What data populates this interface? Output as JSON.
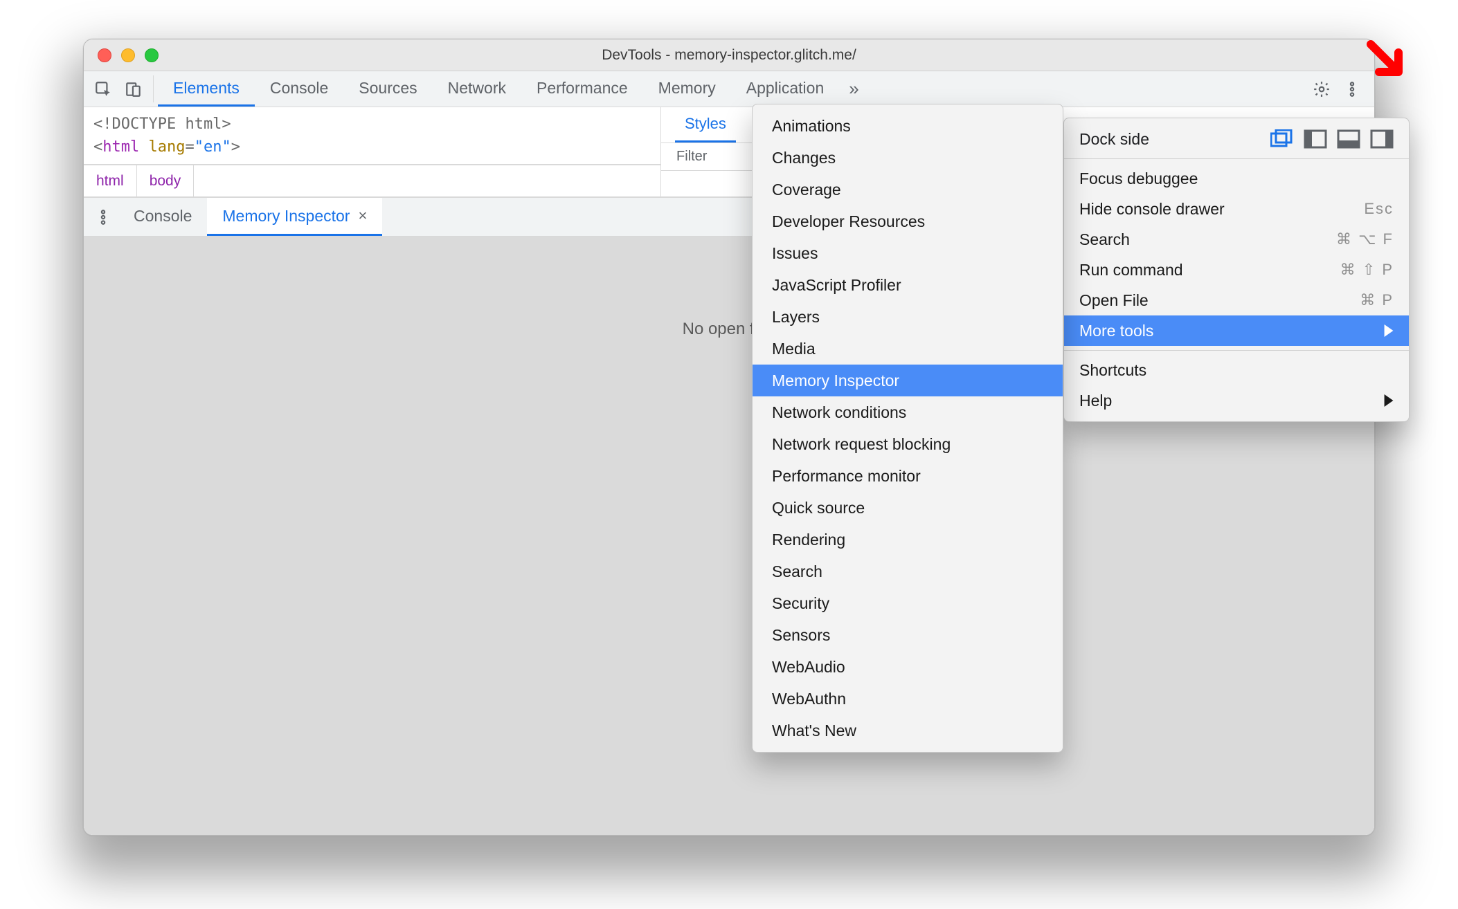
{
  "window": {
    "title": "DevTools - memory-inspector.glitch.me/"
  },
  "tabs": [
    "Elements",
    "Console",
    "Sources",
    "Network",
    "Performance",
    "Memory",
    "Application"
  ],
  "active_tab_index": 0,
  "overflow_glyph": "»",
  "code_line1": "<!DOCTYPE html>",
  "code_line2_pre": "<",
  "code_line2_tag": "html",
  "code_line2_sp": " ",
  "code_line2_attr": "lang",
  "code_line2_eq": "=",
  "code_line2_val": "\"en\"",
  "code_line2_post": ">",
  "breadcrumbs": [
    "html",
    "body"
  ],
  "styles_tabs": [
    "Styles"
  ],
  "filter_label": "Filter",
  "drawer": {
    "tabs": [
      "Console",
      "Memory Inspector"
    ],
    "active_index": 1,
    "body_notice": "No open file."
  },
  "settings_menu": {
    "dock_label": "Dock side",
    "items": [
      {
        "label": "Focus debuggee",
        "kbd": ""
      },
      {
        "label": "Hide console drawer",
        "kbd": "Esc"
      },
      {
        "label": "Search",
        "kbd": "⌘ ⌥ F"
      },
      {
        "label": "Run command",
        "kbd": "⌘ ⇧ P"
      },
      {
        "label": "Open File",
        "kbd": "⌘ P"
      }
    ],
    "more_tools_label": "More tools",
    "footer": [
      {
        "label": "Shortcuts",
        "arrow": false
      },
      {
        "label": "Help",
        "arrow": true
      }
    ]
  },
  "more_tools": [
    "Animations",
    "Changes",
    "Coverage",
    "Developer Resources",
    "Issues",
    "JavaScript Profiler",
    "Layers",
    "Media",
    "Memory Inspector",
    "Network conditions",
    "Network request blocking",
    "Performance monitor",
    "Quick source",
    "Rendering",
    "Search",
    "Security",
    "Sensors",
    "WebAudio",
    "WebAuthn",
    "What's New"
  ],
  "more_tools_highlight_index": 8
}
